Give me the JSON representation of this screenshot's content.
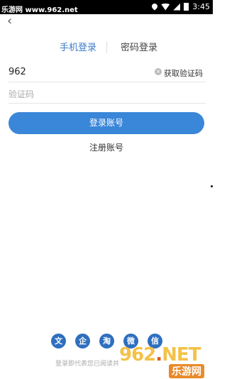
{
  "status_bar": {
    "watermark_site": "乐游网 www.962.net",
    "time": "3:45"
  },
  "tabs": {
    "phone_login": "手机登录",
    "password_login": "密码登录"
  },
  "phone": {
    "value": "962",
    "get_code_label": "获取验证码"
  },
  "code": {
    "placeholder": "验证码"
  },
  "buttons": {
    "login": "登录账号",
    "register": "注册账号"
  },
  "social": [
    "文",
    "企",
    "淘",
    "微",
    "信"
  ],
  "agreement": "登录即代表您已阅读并",
  "watermark": {
    "number": "962",
    "dot": ".",
    "net": "NET",
    "label": "乐游网"
  },
  "colors": {
    "accent": "#3a86d8",
    "tab_active": "#3a7bc8"
  }
}
